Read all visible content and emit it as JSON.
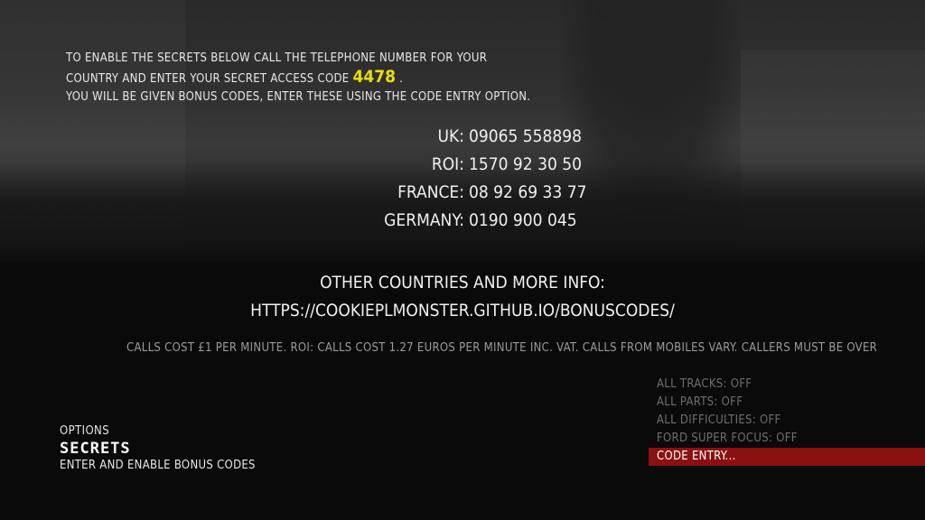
{
  "instructions": {
    "line1": "TO ENABLE THE SECRETS BELOW CALL THE TELEPHONE NUMBER FOR YOUR",
    "line2_prefix": "COUNTRY AND ENTER YOUR SECRET ACCESS CODE",
    "access_code": "4478",
    "line2_suffix": ".",
    "line3": "YOU WILL BE GIVEN BONUS CODES, ENTER THESE USING THE CODE ENTRY OPTION."
  },
  "phones": [
    {
      "country": "UK:",
      "number": "09065 558898"
    },
    {
      "country": "ROI:",
      "number": "1570 92 30 50"
    },
    {
      "country": "FRANCE:",
      "number": "08 92 69 33 77"
    },
    {
      "country": "GERMANY:",
      "number": "0190 900 045"
    }
  ],
  "other_info": {
    "heading": "OTHER COUNTRIES AND MORE INFO:",
    "url": "HTTPS://COOKIEPLMONSTER.GITHUB.IO/BONUSCODES/"
  },
  "costs_text": "CALLS COST £1 PER MINUTE. ROI: CALLS COST 1.27 EUROS PER MINUTE INC. VAT. CALLS FROM MOBILES VARY. CALLERS MUST BE OVER",
  "page": {
    "section": "OPTIONS",
    "title": "SECRETS",
    "description": "ENTER AND ENABLE BONUS CODES"
  },
  "menu": {
    "items": [
      {
        "label": "ALL TRACKS: OFF"
      },
      {
        "label": "ALL PARTS: OFF"
      },
      {
        "label": "ALL DIFFICULTIES: OFF"
      },
      {
        "label": "FORD SUPER FOCUS: OFF"
      },
      {
        "label": "CODE ENTRY..."
      }
    ],
    "selected_label": "CODE ENTRY..."
  },
  "colors": {
    "access_code": "#e8e000",
    "selection_bar": "#8b1010",
    "inactive_menu_text": "#6e6e6e",
    "costs_text": "#9a9a9a"
  }
}
